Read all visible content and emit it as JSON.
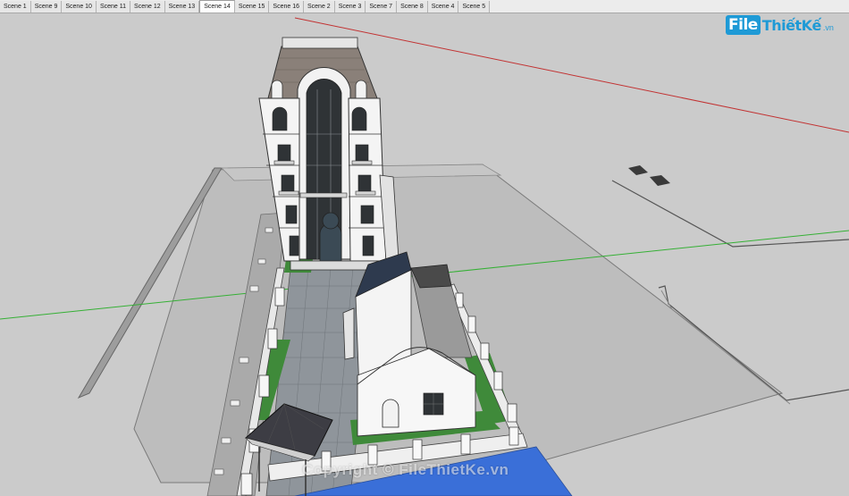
{
  "scene_tabs": {
    "items": [
      {
        "label": "Scene 1"
      },
      {
        "label": "Scene 9"
      },
      {
        "label": "Scene 10"
      },
      {
        "label": "Scene 11"
      },
      {
        "label": "Scene 12"
      },
      {
        "label": "Scene 13"
      },
      {
        "label": "Scene 14",
        "active": true
      },
      {
        "label": "Scene 15"
      },
      {
        "label": "Scene 16"
      },
      {
        "label": "Scene 2"
      },
      {
        "label": "Scene 3"
      },
      {
        "label": "Scene 7"
      },
      {
        "label": "Scene 8"
      },
      {
        "label": "Scene 4"
      },
      {
        "label": "Scene 5"
      }
    ]
  },
  "logo": {
    "box": "File",
    "text": "ThiếtKế",
    "suffix": ".vn"
  },
  "watermark": {
    "text": "Copyright © FileThietKe.vn"
  },
  "colors": {
    "axis_red": "#c23232",
    "axis_green": "#35b035",
    "background": "#c9c9c9",
    "ground": "#b9b9b9",
    "lawn": "#3f8a3a",
    "roof": "#8a8079",
    "pool": "#3a6fd8",
    "logo_blue": "#1e9ad6"
  }
}
